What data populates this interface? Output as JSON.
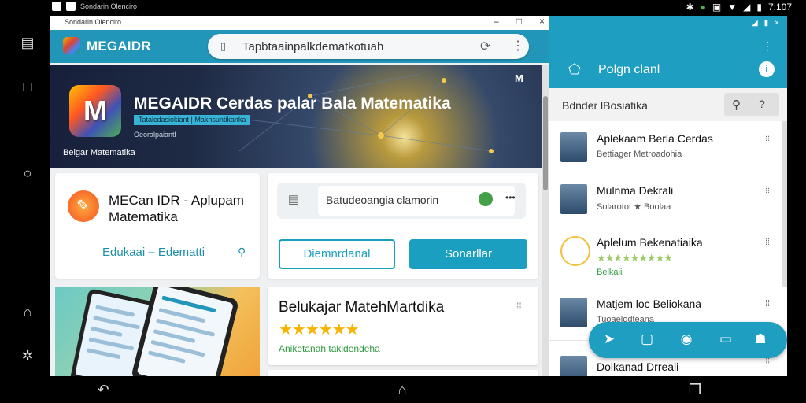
{
  "status_bar": {
    "left_text": "Sondarin Olenciro",
    "time": "7:107",
    "icons": [
      "bluetooth-icon",
      "location-icon",
      "nfc-icon",
      "wifi-icon",
      "signal-icon",
      "battery-icon"
    ]
  },
  "browser": {
    "brand": "MEGAIDR",
    "url": "Tapbtaainpalkdematkotuah",
    "hero": {
      "logo_letter": "M",
      "title": "MEGAIDR Cerdas palar Bala Matematika",
      "sub_badge": "Tatalcdasiokiant | Makhsuntikanka",
      "sub_line2": "Oeoralpaiantl",
      "caption": "Belgar Matematika",
      "corner_letter": "M"
    },
    "app_card": {
      "title": "MECan IDR - Aplupam Matematika",
      "category": "Edukaai – Edematti"
    },
    "search_card": {
      "placeholder": "Batudeoangia clamorin",
      "more": "•••",
      "button_outline": "Diemnrdanal",
      "button_solid": "Sonarllar"
    },
    "feature_card": {
      "title": "Belukajar MatehMartdika",
      "stars": "★★★★★★",
      "subtitle": "Aniketanah takldendeha"
    }
  },
  "panel": {
    "title": "Polgn clanl",
    "info_label": "i",
    "search_text": "Bdnder lBosiatika",
    "items": [
      {
        "title": "Aplekaam Berla Cerdas",
        "sub": "Bettiager Metroadohia"
      },
      {
        "title": "Mulnma Dekrali",
        "sub": "Solarotot ★ Boolaa"
      },
      {
        "title": "Aplelum Bekenatiaika",
        "stars": "★★★★★★★★★",
        "sub": "Belkaii"
      },
      {
        "title": "Matjem loc Beliokana",
        "sub": "Tuoaelodteana"
      },
      {
        "title": "Dolkanad Drreali",
        "sub": ""
      }
    ]
  },
  "colors": {
    "accent": "#1e9ec0",
    "star": "#f6b400",
    "green": "#2e9a3e"
  }
}
